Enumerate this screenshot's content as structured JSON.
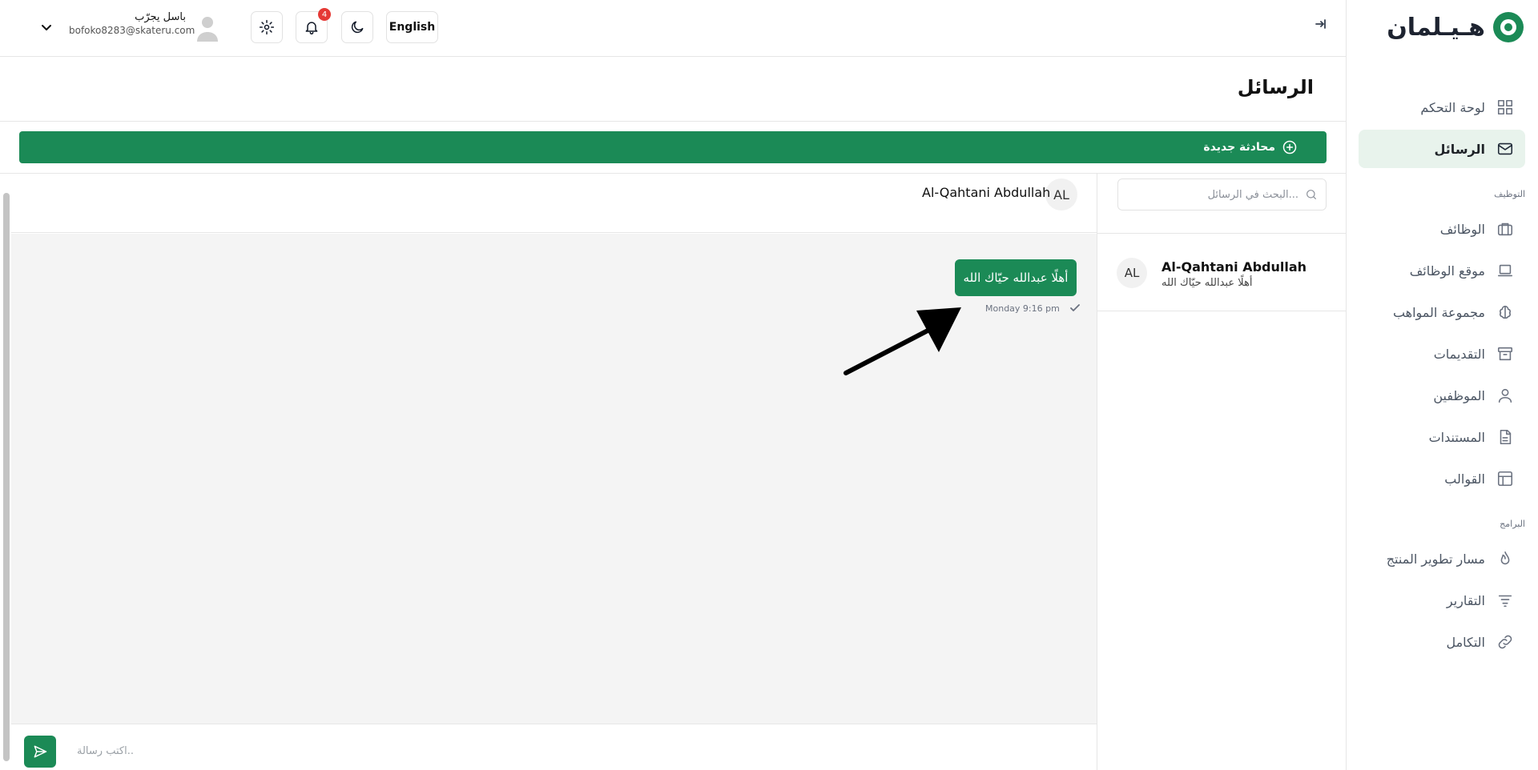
{
  "brand": {
    "logo_text": "هـيـلمان"
  },
  "sidebar": {
    "items": [
      {
        "label": "لوحة التحكم",
        "icon": "dashboard-grid-icon"
      },
      {
        "label": "الرسائل",
        "icon": "mail-icon",
        "active": true
      },
      {
        "label": "الوظائف",
        "icon": "briefcase-icon"
      },
      {
        "label": "موقع الوظائف",
        "icon": "laptop-icon"
      },
      {
        "label": "مجموعة المواهب",
        "icon": "brain-icon"
      },
      {
        "label": "التقديمات",
        "icon": "archive-icon"
      },
      {
        "label": "الموظفين",
        "icon": "user-icon"
      },
      {
        "label": "المستندات",
        "icon": "document-icon"
      },
      {
        "label": "القوالب",
        "icon": "template-icon"
      },
      {
        "label": "مسار تطوير المنتج",
        "icon": "flame-icon"
      },
      {
        "label": "التقارير",
        "icon": "filter-lines-icon"
      },
      {
        "label": "التكامل",
        "icon": "link-icon"
      }
    ],
    "sections": {
      "hiring": "التوظيف",
      "programs": "البرامج"
    }
  },
  "topbar": {
    "language_label": "English",
    "notification_count": "4",
    "user": {
      "name": "باسل يجرّب",
      "email": "bofoko8283@skateru.com"
    }
  },
  "page": {
    "title": "الرسائل",
    "new_chat_label": "محادثة جديدة"
  },
  "search": {
    "placeholder": "البحث في الرسائل..."
  },
  "conversations": [
    {
      "initials": "AL",
      "name": "Al-Qahtani Abdullah",
      "preview": "أهلًا عبدالله حيّاك الله"
    }
  ],
  "chat": {
    "contact": {
      "initials": "AL",
      "name": "Al-Qahtani Abdullah"
    },
    "messages": [
      {
        "text": "أهلًا عبدالله حيّاك الله",
        "time": "Monday 9:16 pm",
        "status": "sent"
      }
    ],
    "composer_placeholder": "اكتب رسالة..",
    "accent_color": "#1b8a56"
  }
}
